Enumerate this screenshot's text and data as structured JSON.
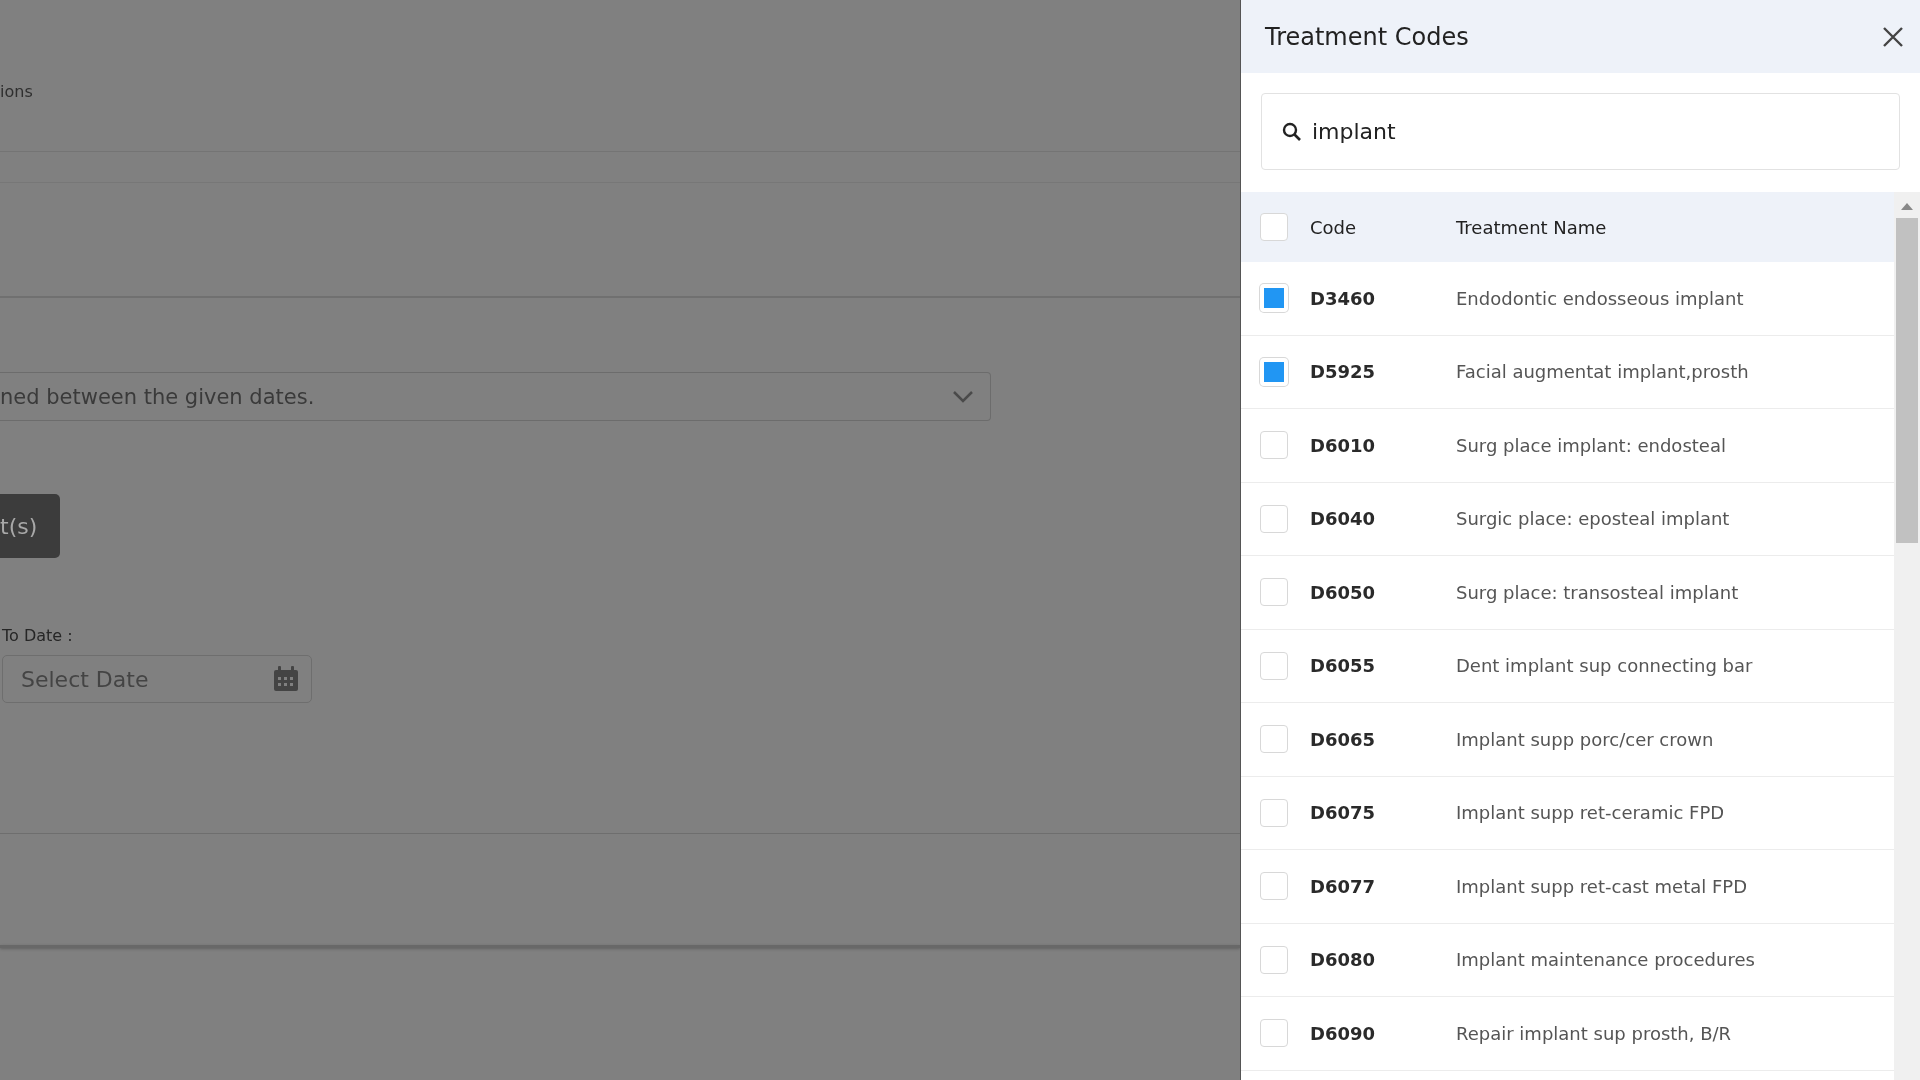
{
  "background": {
    "section_label": "ions",
    "report_dropdown": {
      "value": "ned between the given dates."
    },
    "action_button": "t(s)",
    "to_date": {
      "label": "To Date :",
      "placeholder": "Select Date"
    }
  },
  "panel": {
    "title": "Treatment Codes",
    "search": {
      "value": "implant"
    },
    "table": {
      "columns": [
        "Code",
        "Treatment Name"
      ],
      "select_all_checked": false,
      "rows": [
        {
          "code": "D3460",
          "name": "Endodontic endosseous implant",
          "checked": true
        },
        {
          "code": "D5925",
          "name": "Facial augmentat implant,prosth",
          "checked": true
        },
        {
          "code": "D6010",
          "name": "Surg place implant: endosteal",
          "checked": false
        },
        {
          "code": "D6040",
          "name": "Surgic place: eposteal implant",
          "checked": false
        },
        {
          "code": "D6050",
          "name": "Surg place: transosteal implant",
          "checked": false
        },
        {
          "code": "D6055",
          "name": "Dent implant sup connecting bar",
          "checked": false
        },
        {
          "code": "D6065",
          "name": "Implant supp porc/cer crown",
          "checked": false
        },
        {
          "code": "D6075",
          "name": "Implant supp ret-ceramic FPD",
          "checked": false
        },
        {
          "code": "D6077",
          "name": "Implant supp ret-cast metal FPD",
          "checked": false
        },
        {
          "code": "D6080",
          "name": "Implant maintenance procedures",
          "checked": false
        },
        {
          "code": "D6090",
          "name": "Repair implant sup prosth, B/R",
          "checked": false
        }
      ]
    }
  }
}
